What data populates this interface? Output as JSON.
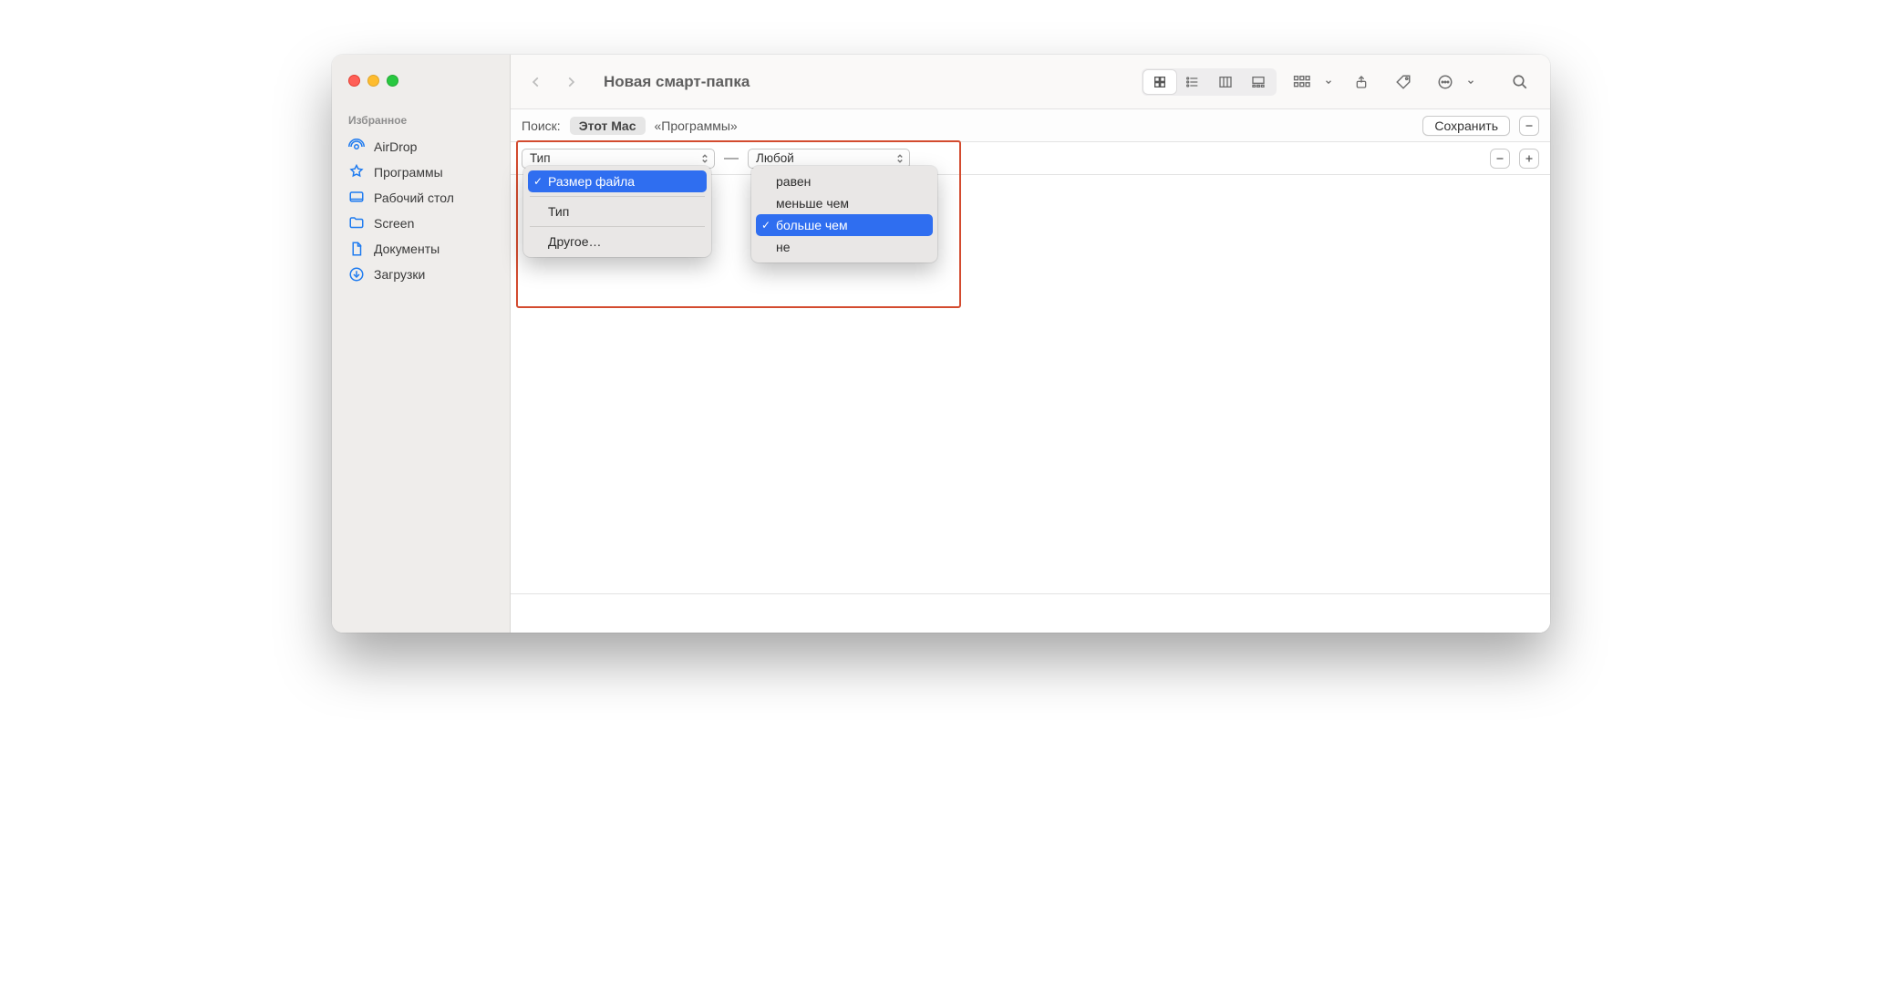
{
  "window": {
    "title": "Новая смарт-папка"
  },
  "sidebar": {
    "section": "Избранное",
    "items": [
      {
        "label": "AirDrop"
      },
      {
        "label": "Программы"
      },
      {
        "label": "Рабочий стол"
      },
      {
        "label": "Screen"
      },
      {
        "label": "Документы"
      },
      {
        "label": "Загрузки"
      }
    ]
  },
  "scope": {
    "label": "Поиск:",
    "selected": "Этот Mac",
    "alt": "«Программы»",
    "save": "Сохранить"
  },
  "rule": {
    "attribute_selected": "Тип",
    "separator": "—",
    "value_selected": "Любой"
  },
  "menu_attribute": {
    "items": [
      {
        "label": "Размер файла",
        "selected": true
      },
      {
        "label": "Тип",
        "selected": false
      },
      {
        "label": "Другое…",
        "selected": false
      }
    ]
  },
  "menu_operator": {
    "items": [
      {
        "label": "равен",
        "selected": false
      },
      {
        "label": "меньше чем",
        "selected": false
      },
      {
        "label": "больше чем",
        "selected": true
      },
      {
        "label": "не",
        "selected": false
      }
    ]
  },
  "colors": {
    "accent": "#2f6ef0",
    "highlight_border": "#d34b2f"
  }
}
